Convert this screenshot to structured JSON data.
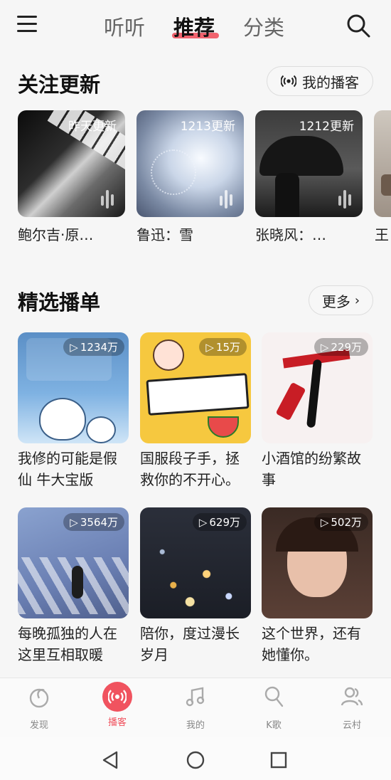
{
  "header": {
    "tabs": [
      "听听",
      "推荐",
      "分类"
    ],
    "active_tab": "推荐"
  },
  "follow": {
    "title": "关注更新",
    "button": "我的播客",
    "items": [
      {
        "badge": "昨天更新",
        "caption": "鲍尔吉·原…",
        "icon": "piano-image"
      },
      {
        "badge": "1213更新",
        "caption": "鲁迅：雪",
        "icon": "snow-image"
      },
      {
        "badge": "1212更新",
        "caption": "张晓风：…",
        "icon": "umbrella-image"
      },
      {
        "badge": "",
        "caption": "王",
        "icon": "partial-image"
      }
    ]
  },
  "playlists": {
    "title": "精选播单",
    "more": "更多",
    "items": [
      {
        "count": "1234万",
        "caption": "我修的可能是假仙 牛大宝版"
      },
      {
        "count": "15万",
        "caption": "国服段子手，拯救你的不开心。"
      },
      {
        "count": "229万",
        "caption": "小酒馆的纷繁故事"
      },
      {
        "count": "3564万",
        "caption": "每晚孤独的人在这里互相取暖"
      },
      {
        "count": "629万",
        "caption": "陪你，度过漫长岁月"
      },
      {
        "count": "502万",
        "caption": "这个世界，还有她懂你。"
      }
    ]
  },
  "bottom_nav": [
    {
      "label": "发现",
      "icon": "netease-icon"
    },
    {
      "label": "播客",
      "icon": "podcast-icon"
    },
    {
      "label": "我的",
      "icon": "music-note-icon"
    },
    {
      "label": "K歌",
      "icon": "microphone-icon"
    },
    {
      "label": "云村",
      "icon": "people-icon"
    }
  ],
  "colors": {
    "accent": "#f0535f",
    "background": "#f6f6f6"
  }
}
